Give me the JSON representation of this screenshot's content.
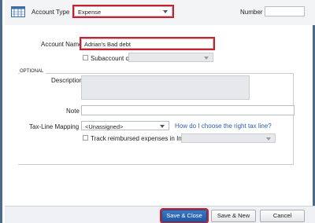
{
  "header": {
    "account_type_label": "Account Type",
    "account_type_value": "Expense",
    "number_label": "Number",
    "number_value": ""
  },
  "form": {
    "account_name_label": "Account Name",
    "account_name_value": "Adrian's Bad debt",
    "subaccount_label": "Subaccount of",
    "subaccount_value": ""
  },
  "optional": {
    "section_label": "OPTIONAL",
    "description_label": "Description",
    "description_value": "",
    "note_label": "Note",
    "note_value": "",
    "tax_line_label": "Tax-Line Mapping",
    "tax_line_value": "<Unassigned>",
    "tax_help_link": "How do I choose the right tax line?",
    "track_reimbursed_label": "Track reimbursed expenses in Income Acct.",
    "income_acct_value": ""
  },
  "buttons": {
    "save_close": "Save & Close",
    "save_new": "Save & New",
    "cancel": "Cancel"
  },
  "colors": {
    "highlight": "#cc1f2f",
    "primary_button": "#1f5aa3",
    "link": "#2a5db0"
  }
}
